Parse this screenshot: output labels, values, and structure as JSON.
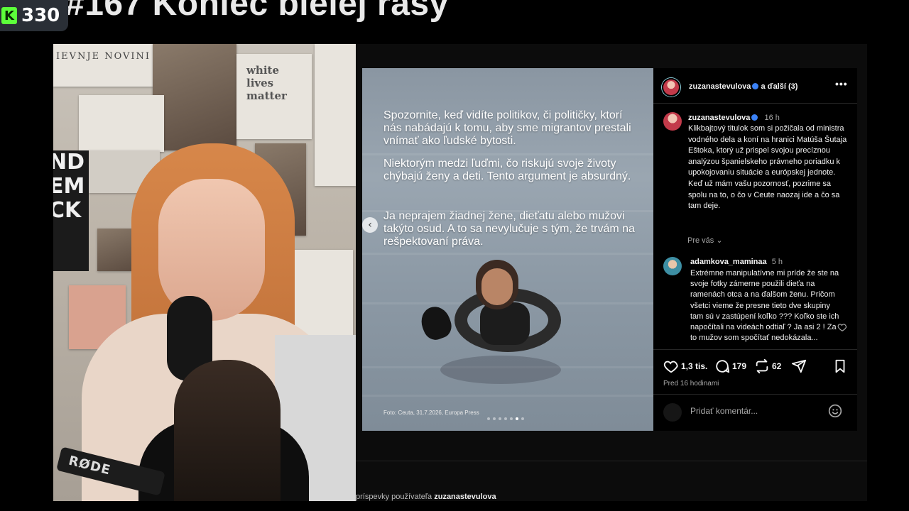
{
  "stream": {
    "title": "#167 Koniec bielej rasy",
    "badge_letter": "K",
    "badge_count": "330"
  },
  "video": {
    "poster_lines": [
      "white",
      "lives",
      "matter"
    ],
    "newspaper_head": "IEVNJE NOVINI",
    "black_poster_lines": [
      "ND",
      "EM",
      "CK"
    ],
    "mic_brand": "RØDE"
  },
  "post": {
    "text_blocks": [
      "Spozornite, keď vidíte politikov, či političky, ktorí nás nabádajú k tomu, aby sme migrantov prestali vnímať ako ľudské bytosti.",
      "Niektorým medzi ľuďmi, čo riskujú svoje životy chýbajú ženy a deti. Tento argument je absurdný.",
      "Ja neprajem žiadnej žene, dieťatu alebo mužovi takýto osud. A to sa nevylučuje s tým, že trvám na rešpektovaní práva."
    ],
    "credit": "Foto: Ceuta, 31.7.2026, Europa Press",
    "carousel_total": 7,
    "carousel_active": 6
  },
  "sidebar": {
    "header_user": "zuzanastevulova",
    "header_extra": "a ďalší (3)",
    "author": "zuzanastevulova",
    "author_time": "16 h",
    "caption": "Klikbajtový titulok som si požičala od ministra vodného dela a koní na hranici Matúša Šutaja Eštoka, ktorý už prispel svojou precíznou analýzou španielskeho právneho poriadku k upokojovaniu situácie a európskej jednote. Keď už mám vašu pozornosť, pozrime sa spolu na to, o čo v Ceute naozaj ide a čo sa tam deje.",
    "pre_vas": "Pre vás",
    "comment_user": "adamkova_maminaa",
    "comment_time": "5 h",
    "comment_text": "Extrémne manipulatívne mi príde že ste na svoje fotky zámerne použili dieťa na ramenách otca a na ďalšom ženu. Pričom všetci vieme že presne tieto dve skupiny tam sú v zastúpení koľko ??? Koľko ste ich napočítali na videách odtiaľ ? Ja asi 2 ! Za to mužov som spočítať nedokázala...",
    "likes": "1,3 tis.",
    "comments": "179",
    "reposts": "62",
    "timestamp": "Pred 16 hodinami",
    "comment_placeholder": "Pridať komentár..."
  },
  "footer": {
    "prefix": "príspevky používateľa",
    "user": "zuzanastevulova"
  }
}
